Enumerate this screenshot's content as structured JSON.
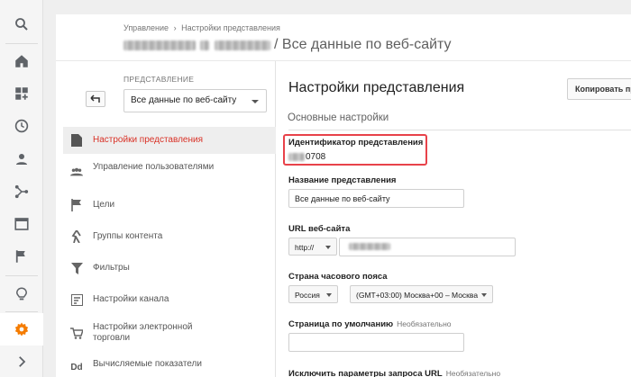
{
  "header": {
    "breadcrumb": [
      "Управление",
      "Настройки представления"
    ],
    "breadcrumb_sep": "›",
    "title_suffix": "/ Все данные по веб-сайту"
  },
  "rail": {
    "items": [
      "search-icon",
      "home-icon",
      "dashboard-add-icon",
      "clock-icon",
      "person-icon",
      "share-icon",
      "window-icon",
      "flag-icon",
      "lightbulb-icon",
      "gear-icon",
      "chevron-right-icon"
    ],
    "accent": "#f57c00"
  },
  "panel": {
    "view_label": "ПРЕДСТАВЛЕНИЕ",
    "view_selected": "Все данные по веб-сайту",
    "nav": [
      {
        "label": "Настройки представления",
        "icon": "document-icon",
        "active": true
      },
      {
        "label": "Управление пользователями",
        "icon": "people-icon"
      },
      {
        "label": "Цели",
        "icon": "flag-icon"
      },
      {
        "label": "Группы контента",
        "icon": "figure-icon"
      },
      {
        "label": "Фильтры",
        "icon": "filter-icon"
      },
      {
        "label": "Настройки канала",
        "icon": "channel-icon"
      },
      {
        "label": "Настройки электронной торговли",
        "icon": "cart-icon"
      },
      {
        "label": "Вычисляемые показатели",
        "icon": "dd-icon"
      }
    ],
    "active_color": "#d93025"
  },
  "main": {
    "title": "Настройки представления",
    "copy_button": "Копировать пре",
    "section": "Основные настройки",
    "view_id_label": "Идентификатор представления",
    "view_id_value": "0708",
    "view_name_label": "Название представления",
    "view_name_value": "Все данные по веб-сайту",
    "url_label": "URL веб-сайта",
    "url_protocol": "http://",
    "tz_label": "Страна часового пояса",
    "tz_country": "Россия",
    "tz_zone": "(GMT+03:00) Москва+00 – Москва",
    "default_page_label": "Страница по умолчанию",
    "optional": "Необязательно",
    "exclude_label": "Исключить параметры запроса URL",
    "exclude_optional": "Необязательно",
    "highlight_color": "#e8424a"
  }
}
